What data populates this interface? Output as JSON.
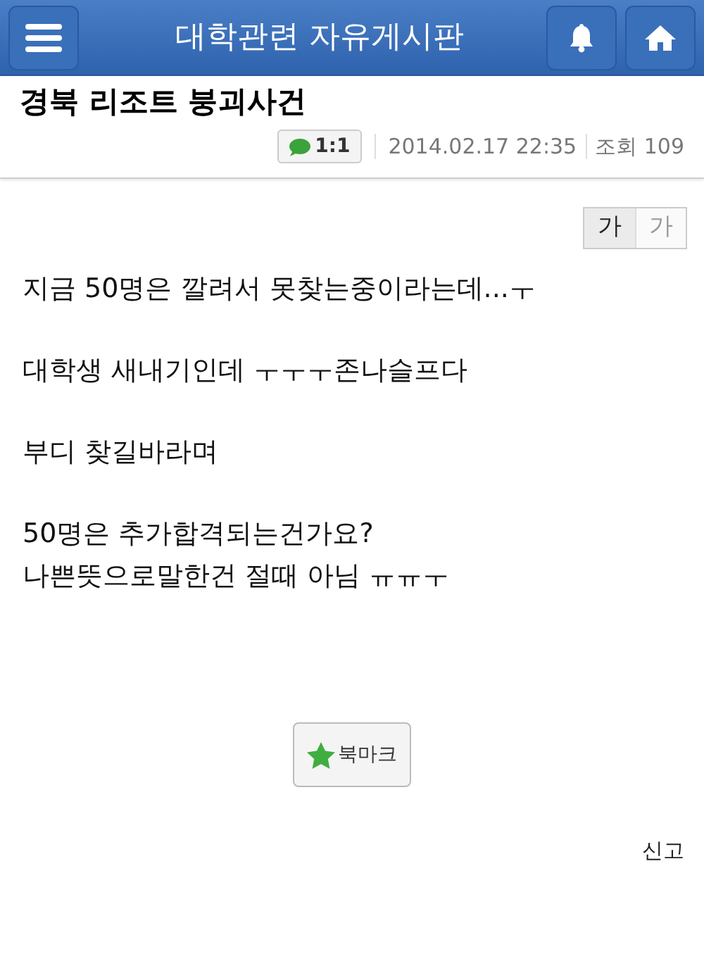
{
  "header": {
    "title": "대학관련 자유게시판"
  },
  "post": {
    "title": "경북 리조트 붕괴사건",
    "chat_badge": "1:1",
    "date": "2014.02.17 22:35",
    "views": "조회 109"
  },
  "font_sizes": [
    {
      "label": "가",
      "selected": true
    },
    {
      "label": "가",
      "selected": false
    }
  ],
  "paragraphs": [
    [
      "지금 50명은 깔려서 못찾는중이라는데...ㅜ"
    ],
    [
      "대학생 새내기인데 ㅜㅜㅜ존나슬프다"
    ],
    [
      "부디 찾길바라며"
    ],
    [
      "50명은 추가합격되는건가요?",
      "나쁜뜻으로말한건 절때 아님 ㅠㅠㅜ"
    ]
  ],
  "bookmark_button": "북마크",
  "report_link": "신고"
}
